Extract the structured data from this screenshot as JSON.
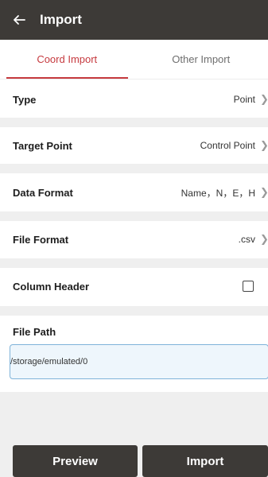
{
  "app": {
    "title": "Import"
  },
  "tabs": [
    {
      "label": "Coord Import",
      "active": true
    },
    {
      "label": "Other Import",
      "active": false
    }
  ],
  "settings": [
    {
      "label": "Type",
      "value": "Point"
    },
    {
      "label": "Target Point",
      "value": "Control Point"
    },
    {
      "label": "Data Format",
      "value": "Name，N，E，H"
    },
    {
      "label": "File Format",
      "value": ".csv"
    }
  ],
  "column_header": {
    "label": "Column Header",
    "checked": false
  },
  "file_path": {
    "label": "File Path",
    "value": "/storage/emulated/0"
  },
  "buttons": {
    "preview": "Preview",
    "import": "Import"
  },
  "colors": {
    "accent": "#c63a3f",
    "bar": "#3d3a37"
  }
}
